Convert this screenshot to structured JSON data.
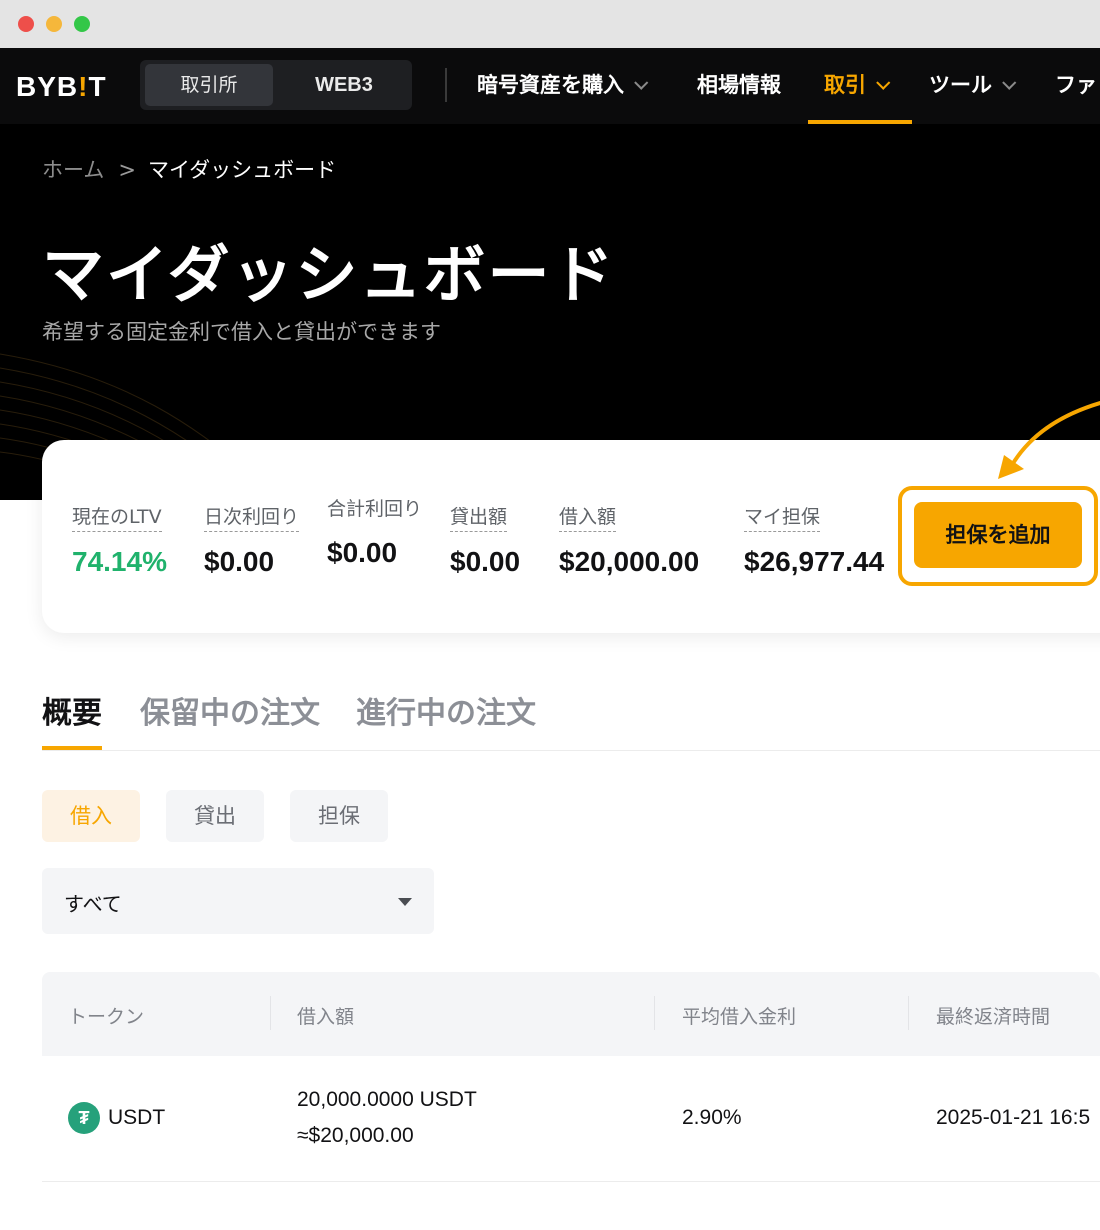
{
  "nav": {
    "logo": "BYB",
    "logo_bang": "!",
    "logo_end": "T",
    "segments": [
      "取引所",
      "WEB3"
    ],
    "items": [
      "暗号資産を購入",
      "相場情報",
      "取引",
      "ツール",
      "ファ"
    ]
  },
  "breadcrumb": {
    "home": "ホーム",
    "separator": ">",
    "current": "マイダッシュボード"
  },
  "page": {
    "title": "マイダッシュボード",
    "subtitle": "希望する固定金利で借入と貸出ができます"
  },
  "summary": {
    "metrics": [
      {
        "label": "現在のLTV",
        "value": "74.14%"
      },
      {
        "label": "日次利回り",
        "value": "$0.00"
      },
      {
        "label": "合計利回り",
        "value": "$0.00"
      },
      {
        "label": "貸出額",
        "value": "$0.00"
      },
      {
        "label": "借入額",
        "value": "$20,000.00"
      },
      {
        "label": "マイ担保",
        "value": "$26,977.44"
      }
    ],
    "add_collateral_label": "担保を追加"
  },
  "tabs": [
    "概要",
    "保留中の注文",
    "進行中の注文"
  ],
  "subtabs": [
    "借入",
    "貸出",
    "担保"
  ],
  "filter": {
    "selected": "すべて"
  },
  "table": {
    "headers": [
      "トークン",
      "借入額",
      "平均借入金利",
      "最終返済時間"
    ],
    "rows": [
      {
        "token": "USDT",
        "icon_glyph": "₮",
        "amount": "20,000.0000 USDT",
        "amount_usd": "≈$20,000.00",
        "rate": "2.90%",
        "due": "2025-01-21 16:5"
      }
    ]
  },
  "colors": {
    "accent": "#f7a600",
    "positive": "#20b26c",
    "usdt": "#26a17b"
  }
}
